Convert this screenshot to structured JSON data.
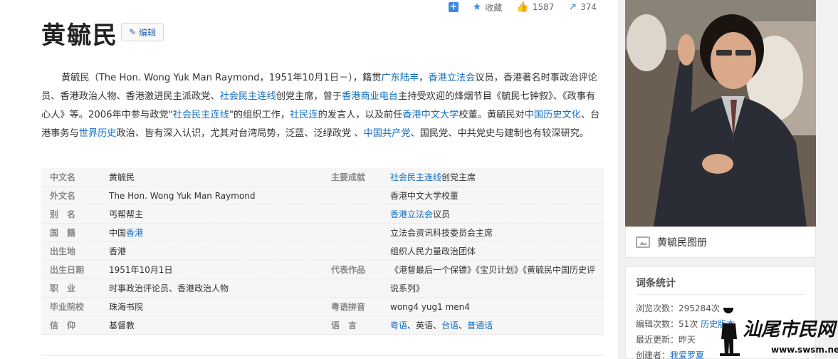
{
  "toolbar": {
    "plus_icon": "plus-icon",
    "collect_label": "收藏",
    "like_count": "1587",
    "share_count": "374"
  },
  "title": "黄毓民",
  "edit_label": "编辑",
  "intro": {
    "t1": "黄毓民（The Hon. Wong Yuk Man Raymond，1951年10月1日－），籍贯",
    "l1": "广东陆丰",
    "t2": "，",
    "l2": "香港立法会",
    "t3": "议员，香港著名时事政治评论员、香港政治人物、香港激进民主派政党、",
    "l3": "社会民主连线",
    "t4": "创党主席，曾于",
    "l4": "香港商业电台",
    "t5": "主持受欢迎的烽烟节目《毓民七钟叙》、《政事有心人》等。2006年中参与政党\"",
    "l5": "社会民主连线",
    "t6": "\"的组织工作，",
    "l6": "社民连",
    "t7": "的发言人，以及前任",
    "l7": "香港中文大学",
    "t8": "校董。黄毓民对",
    "l8": "中国历史文化",
    "t9": "、台港事务与",
    "l9": "世界历史",
    "t10": "政治、皆有深入认识，尤其对台湾局势，泛蓝、泛绿政党 、",
    "l10": "中国共产党",
    "t11": "、国民党、中共党史与建制也有较深研究。"
  },
  "basic": {
    "r1": {
      "k1": "中文名",
      "v1": "黄毓民",
      "k2": "主要成就",
      "v2a": "社会民主连线",
      "v2b": "创党主席"
    },
    "r2": {
      "k1": "外文名",
      "v1": "The Hon. Wong Yuk Man Raymond",
      "k2": "",
      "v2": "香港中文大学校董"
    },
    "r3": {
      "k1": "别　名",
      "v1": "丐帮帮主",
      "k2": "",
      "v2a": "香港立法会",
      "v2b": "议员"
    },
    "r4": {
      "k1": "国　籍",
      "v1a": "中国",
      "v1b": "香港",
      "k2": "",
      "v2": "立法会资讯科技委员会主席"
    },
    "r5": {
      "k1": "出生地",
      "v1": "香港",
      "k2": "",
      "v2": "组织人民力量政治团体"
    },
    "r6": {
      "k1": "出生日期",
      "v1": "1951年10月1日",
      "k2": "代表作品",
      "v2": "《港督最后一个保镖》《宝贝计划》《黄毓民中国历史评"
    },
    "r7": {
      "k1": "职　业",
      "v1": "时事政治评论员、香港政治人物",
      "k2": "",
      "v2": "说系列》"
    },
    "r8": {
      "k1": "毕业院校",
      "v1": "珠海书院",
      "k2": "粤语拼音",
      "v2": "wong4 yug1 men4"
    },
    "r9": {
      "k1": "信　仰",
      "v1": "基督教",
      "k2": "语　言",
      "l1": "粤语",
      "s1": "、英语、",
      "l2": "台语",
      "s2": "、",
      "l3": "普通话"
    }
  },
  "sidebar": {
    "album_label": "黄毓民图册",
    "stats_title": "词条统计",
    "views_label": "浏览次数：",
    "views_value": "295284次",
    "edits_label": "编辑次数：",
    "edits_value": "51次",
    "history_link": "历史版本",
    "updated_label": "最近更新：",
    "updated_value": "昨天",
    "creator_label": "创建者：",
    "creator_value": "我爱罗夏"
  },
  "watermark": {
    "name": "汕尾市民网",
    "url": "www.swsm.net"
  }
}
